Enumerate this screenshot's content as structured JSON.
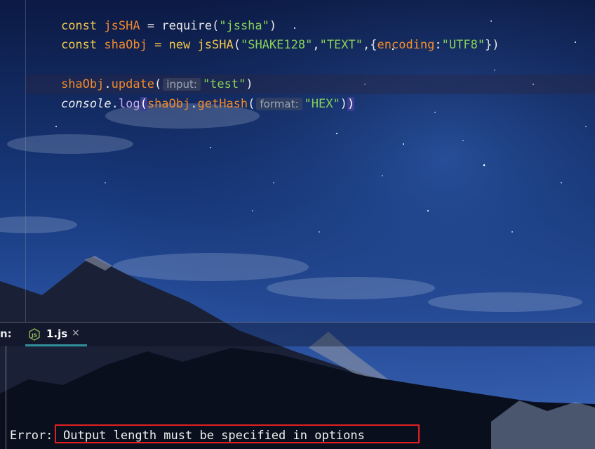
{
  "editor": {
    "lines": [
      {
        "kw": "const",
        "var": "jsSHA",
        "eq": "=",
        "fn": "require",
        "open": "(",
        "str": "\"jssha\"",
        "close": ")"
      },
      {
        "kw": "const",
        "var": "shaObj",
        "eq": "=",
        "kw2": "new",
        "cls": "jsSHA",
        "open": "(",
        "arg1": "\"SHAKE128\"",
        "comma1": ",",
        "arg2": "\"TEXT\"",
        "comma2": ",",
        "brace_open": "{",
        "key": "encoding",
        "colon": ":",
        "arg3": "\"UTF8\"",
        "brace_close": "}",
        "close": ")"
      },
      {
        "obj": "shaObj",
        "dot": ".",
        "method": "update",
        "open": "(",
        "hint": "input:",
        "str": "\"test\"",
        "close": ")"
      },
      {
        "obj": "console",
        "dot": ".",
        "method": "log",
        "open": "(",
        "obj2": "shaObj",
        "dot2": ".",
        "method2": "getHash",
        "open2": "(",
        "hint": "format:",
        "str": "\"HEX\"",
        "close2": ")",
        "close": ")"
      }
    ]
  },
  "tool_window": {
    "run_label": "n:",
    "tab": {
      "name": "1.js",
      "close": "×",
      "icon": "nodejs-icon"
    }
  },
  "console": {
    "error_prefix": "Error:",
    "error_message": "Output length must be specified in options"
  },
  "colors": {
    "keyword": "#f3c84a",
    "variable": "#f18a2c",
    "string": "#87d15a",
    "error_box": "#e02020",
    "tab_accent": "#2f8f9c"
  }
}
